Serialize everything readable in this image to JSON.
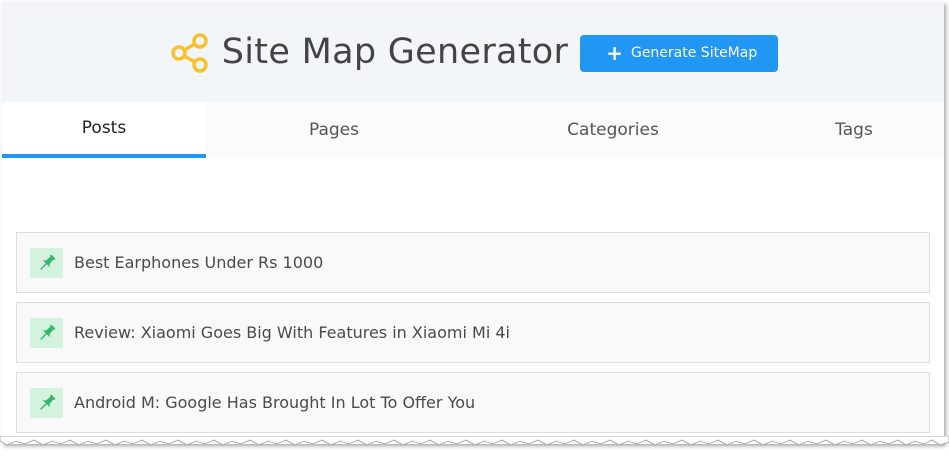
{
  "header": {
    "title": "Site Map Generator",
    "generate_button": "Generate SiteMap",
    "logo_icon": "share-icon",
    "accent_color": "#2196f3",
    "logo_color": "#fbc02d"
  },
  "tabs": [
    {
      "label": "Posts",
      "active": true
    },
    {
      "label": "Pages",
      "active": false
    },
    {
      "label": "Categories",
      "active": false
    },
    {
      "label": "Tags",
      "active": false
    }
  ],
  "posts": [
    {
      "title": "Best Earphones Under Rs 1000",
      "icon": "pin-icon"
    },
    {
      "title": "Review: Xiaomi Goes Big With Features in Xiaomi Mi 4i",
      "icon": "pin-icon"
    },
    {
      "title": "Android M: Google Has Brought In Lot To Offer You",
      "icon": "pin-icon"
    }
  ]
}
